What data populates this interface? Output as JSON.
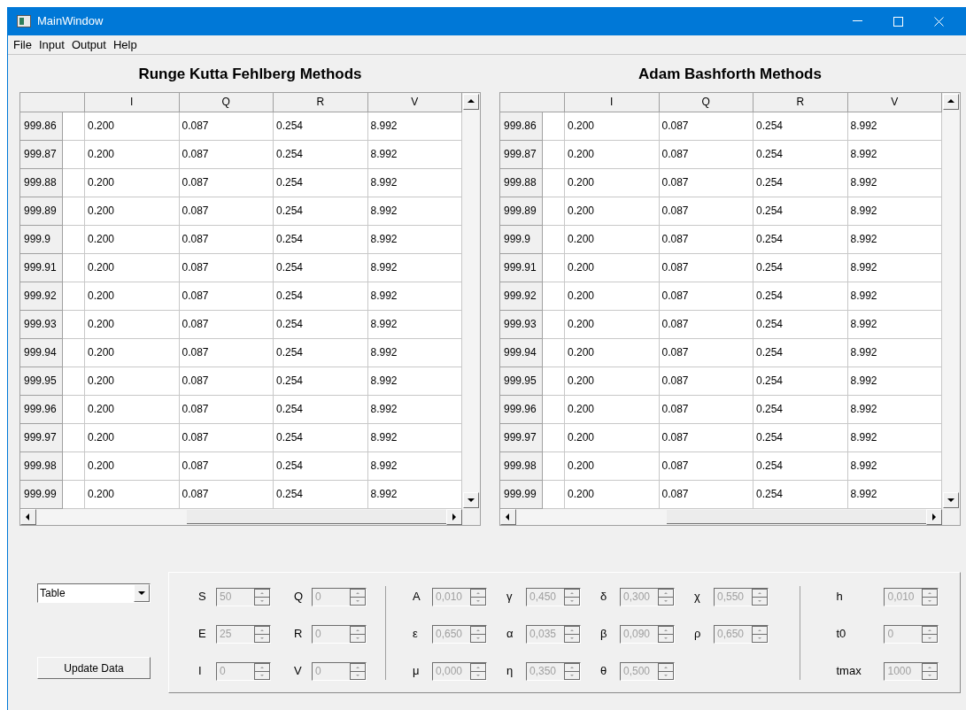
{
  "window": {
    "title": "MainWindow"
  },
  "menu": [
    {
      "label": "File"
    },
    {
      "label": "Input"
    },
    {
      "label": "Output"
    },
    {
      "label": "Help"
    }
  ],
  "tables": [
    {
      "title": "Runge Kutta Fehlberg Methods",
      "columns": [
        "I",
        "Q",
        "R",
        "V"
      ],
      "rows": [
        {
          "label": "999.86",
          "cells": [
            "0.200",
            "0.087",
            "0.254",
            "8.992"
          ]
        },
        {
          "label": "999.87",
          "cells": [
            "0.200",
            "0.087",
            "0.254",
            "8.992"
          ]
        },
        {
          "label": "999.88",
          "cells": [
            "0.200",
            "0.087",
            "0.254",
            "8.992"
          ]
        },
        {
          "label": "999.89",
          "cells": [
            "0.200",
            "0.087",
            "0.254",
            "8.992"
          ]
        },
        {
          "label": "999.9",
          "cells": [
            "0.200",
            "0.087",
            "0.254",
            "8.992"
          ]
        },
        {
          "label": "999.91",
          "cells": [
            "0.200",
            "0.087",
            "0.254",
            "8.992"
          ]
        },
        {
          "label": "999.92",
          "cells": [
            "0.200",
            "0.087",
            "0.254",
            "8.992"
          ]
        },
        {
          "label": "999.93",
          "cells": [
            "0.200",
            "0.087",
            "0.254",
            "8.992"
          ]
        },
        {
          "label": "999.94",
          "cells": [
            "0.200",
            "0.087",
            "0.254",
            "8.992"
          ]
        },
        {
          "label": "999.95",
          "cells": [
            "0.200",
            "0.087",
            "0.254",
            "8.992"
          ]
        },
        {
          "label": "999.96",
          "cells": [
            "0.200",
            "0.087",
            "0.254",
            "8.992"
          ]
        },
        {
          "label": "999.97",
          "cells": [
            "0.200",
            "0.087",
            "0.254",
            "8.992"
          ]
        },
        {
          "label": "999.98",
          "cells": [
            "0.200",
            "0.087",
            "0.254",
            "8.992"
          ]
        },
        {
          "label": "999.99",
          "cells": [
            "0.200",
            "0.087",
            "0.254",
            "8.992"
          ]
        }
      ]
    },
    {
      "title": "Adam Bashforth Methods",
      "columns": [
        "I",
        "Q",
        "R",
        "V"
      ],
      "rows": [
        {
          "label": "999.86",
          "cells": [
            "0.200",
            "0.087",
            "0.254",
            "8.992"
          ]
        },
        {
          "label": "999.87",
          "cells": [
            "0.200",
            "0.087",
            "0.254",
            "8.992"
          ]
        },
        {
          "label": "999.88",
          "cells": [
            "0.200",
            "0.087",
            "0.254",
            "8.992"
          ]
        },
        {
          "label": "999.89",
          "cells": [
            "0.200",
            "0.087",
            "0.254",
            "8.992"
          ]
        },
        {
          "label": "999.9",
          "cells": [
            "0.200",
            "0.087",
            "0.254",
            "8.992"
          ]
        },
        {
          "label": "999.91",
          "cells": [
            "0.200",
            "0.087",
            "0.254",
            "8.992"
          ]
        },
        {
          "label": "999.92",
          "cells": [
            "0.200",
            "0.087",
            "0.254",
            "8.992"
          ]
        },
        {
          "label": "999.93",
          "cells": [
            "0.200",
            "0.087",
            "0.254",
            "8.992"
          ]
        },
        {
          "label": "999.94",
          "cells": [
            "0.200",
            "0.087",
            "0.254",
            "8.992"
          ]
        },
        {
          "label": "999.95",
          "cells": [
            "0.200",
            "0.087",
            "0.254",
            "8.992"
          ]
        },
        {
          "label": "999.96",
          "cells": [
            "0.200",
            "0.087",
            "0.254",
            "8.992"
          ]
        },
        {
          "label": "999.97",
          "cells": [
            "0.200",
            "0.087",
            "0.254",
            "8.992"
          ]
        },
        {
          "label": "999.98",
          "cells": [
            "0.200",
            "0.087",
            "0.254",
            "8.992"
          ]
        },
        {
          "label": "999.99",
          "cells": [
            "0.200",
            "0.087",
            "0.254",
            "8.992"
          ]
        }
      ]
    }
  ],
  "view_select": {
    "value": "Table"
  },
  "update_button": {
    "label": "Update Data"
  },
  "parameters": {
    "groups": [
      {
        "columns": [
          [
            {
              "label": "S",
              "value": "50",
              "disabled": true
            },
            {
              "label": "E",
              "value": "25",
              "disabled": true
            },
            {
              "label": "I",
              "value": "0",
              "disabled": true
            }
          ],
          [
            {
              "label": "Q",
              "value": "0",
              "disabled": true
            },
            {
              "label": "R",
              "value": "0",
              "disabled": true
            },
            {
              "label": "V",
              "value": "0",
              "disabled": true
            }
          ]
        ]
      },
      {
        "columns": [
          [
            {
              "label": "A",
              "value": "0,010",
              "disabled": true
            },
            {
              "label": "ε",
              "value": "0,650",
              "disabled": true
            },
            {
              "label": "μ",
              "value": "0,000",
              "disabled": true
            }
          ],
          [
            {
              "label": "γ",
              "value": "0,450",
              "disabled": true
            },
            {
              "label": "α",
              "value": "0,035",
              "disabled": true
            },
            {
              "label": "η",
              "value": "0,350",
              "disabled": true
            }
          ],
          [
            {
              "label": "δ",
              "value": "0,300",
              "disabled": true
            },
            {
              "label": "β",
              "value": "0,090",
              "disabled": true
            },
            {
              "label": "θ",
              "value": "0,500",
              "disabled": true
            }
          ],
          [
            {
              "label": "χ",
              "value": "0,550",
              "disabled": true
            },
            {
              "label": "ρ",
              "value": "0,650",
              "disabled": true
            }
          ]
        ]
      },
      {
        "columns": [
          [
            {
              "label": "h",
              "value": "0,010",
              "disabled": true
            },
            {
              "label": "t0",
              "value": "0",
              "disabled": true
            },
            {
              "label": "tmax",
              "value": "1000",
              "disabled": true
            }
          ]
        ]
      }
    ]
  }
}
